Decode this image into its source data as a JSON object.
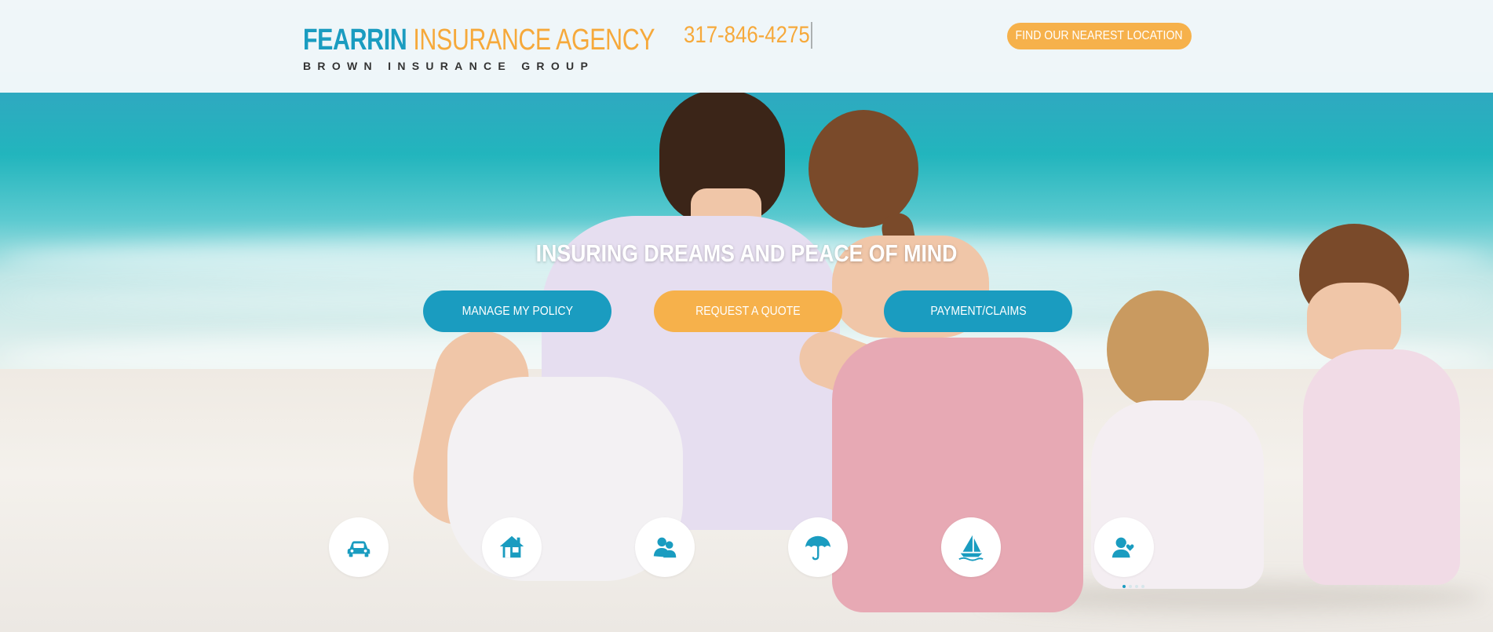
{
  "header": {
    "logo": {
      "line1_part1": "FEARRIN",
      "line1_part2": "INSURANCE AGENCY",
      "line2": "BROWN INSURANCE GROUP"
    },
    "phone": "317-846-4275",
    "location_button": "FIND OUR NEAREST LOCATION"
  },
  "hero": {
    "headline": "INSURING DREAMS AND PEACE OF MIND",
    "buttons": [
      "MANAGE MY POLICY",
      "REQUEST A QUOTE",
      "PAYMENT/CLAIMS"
    ]
  },
  "products": [
    {
      "icon": "car-icon"
    },
    {
      "icon": "home-icon"
    },
    {
      "icon": "business-people-icon"
    },
    {
      "icon": "umbrella-icon"
    },
    {
      "icon": "sailboat-icon"
    },
    {
      "icon": "life-heart-person-icon"
    }
  ],
  "carousel": {
    "dots": 4,
    "active_index": 0
  },
  "colors": {
    "brand_blue": "#1a9cc0",
    "brand_orange": "#f6b14b",
    "white": "#ffffff"
  }
}
